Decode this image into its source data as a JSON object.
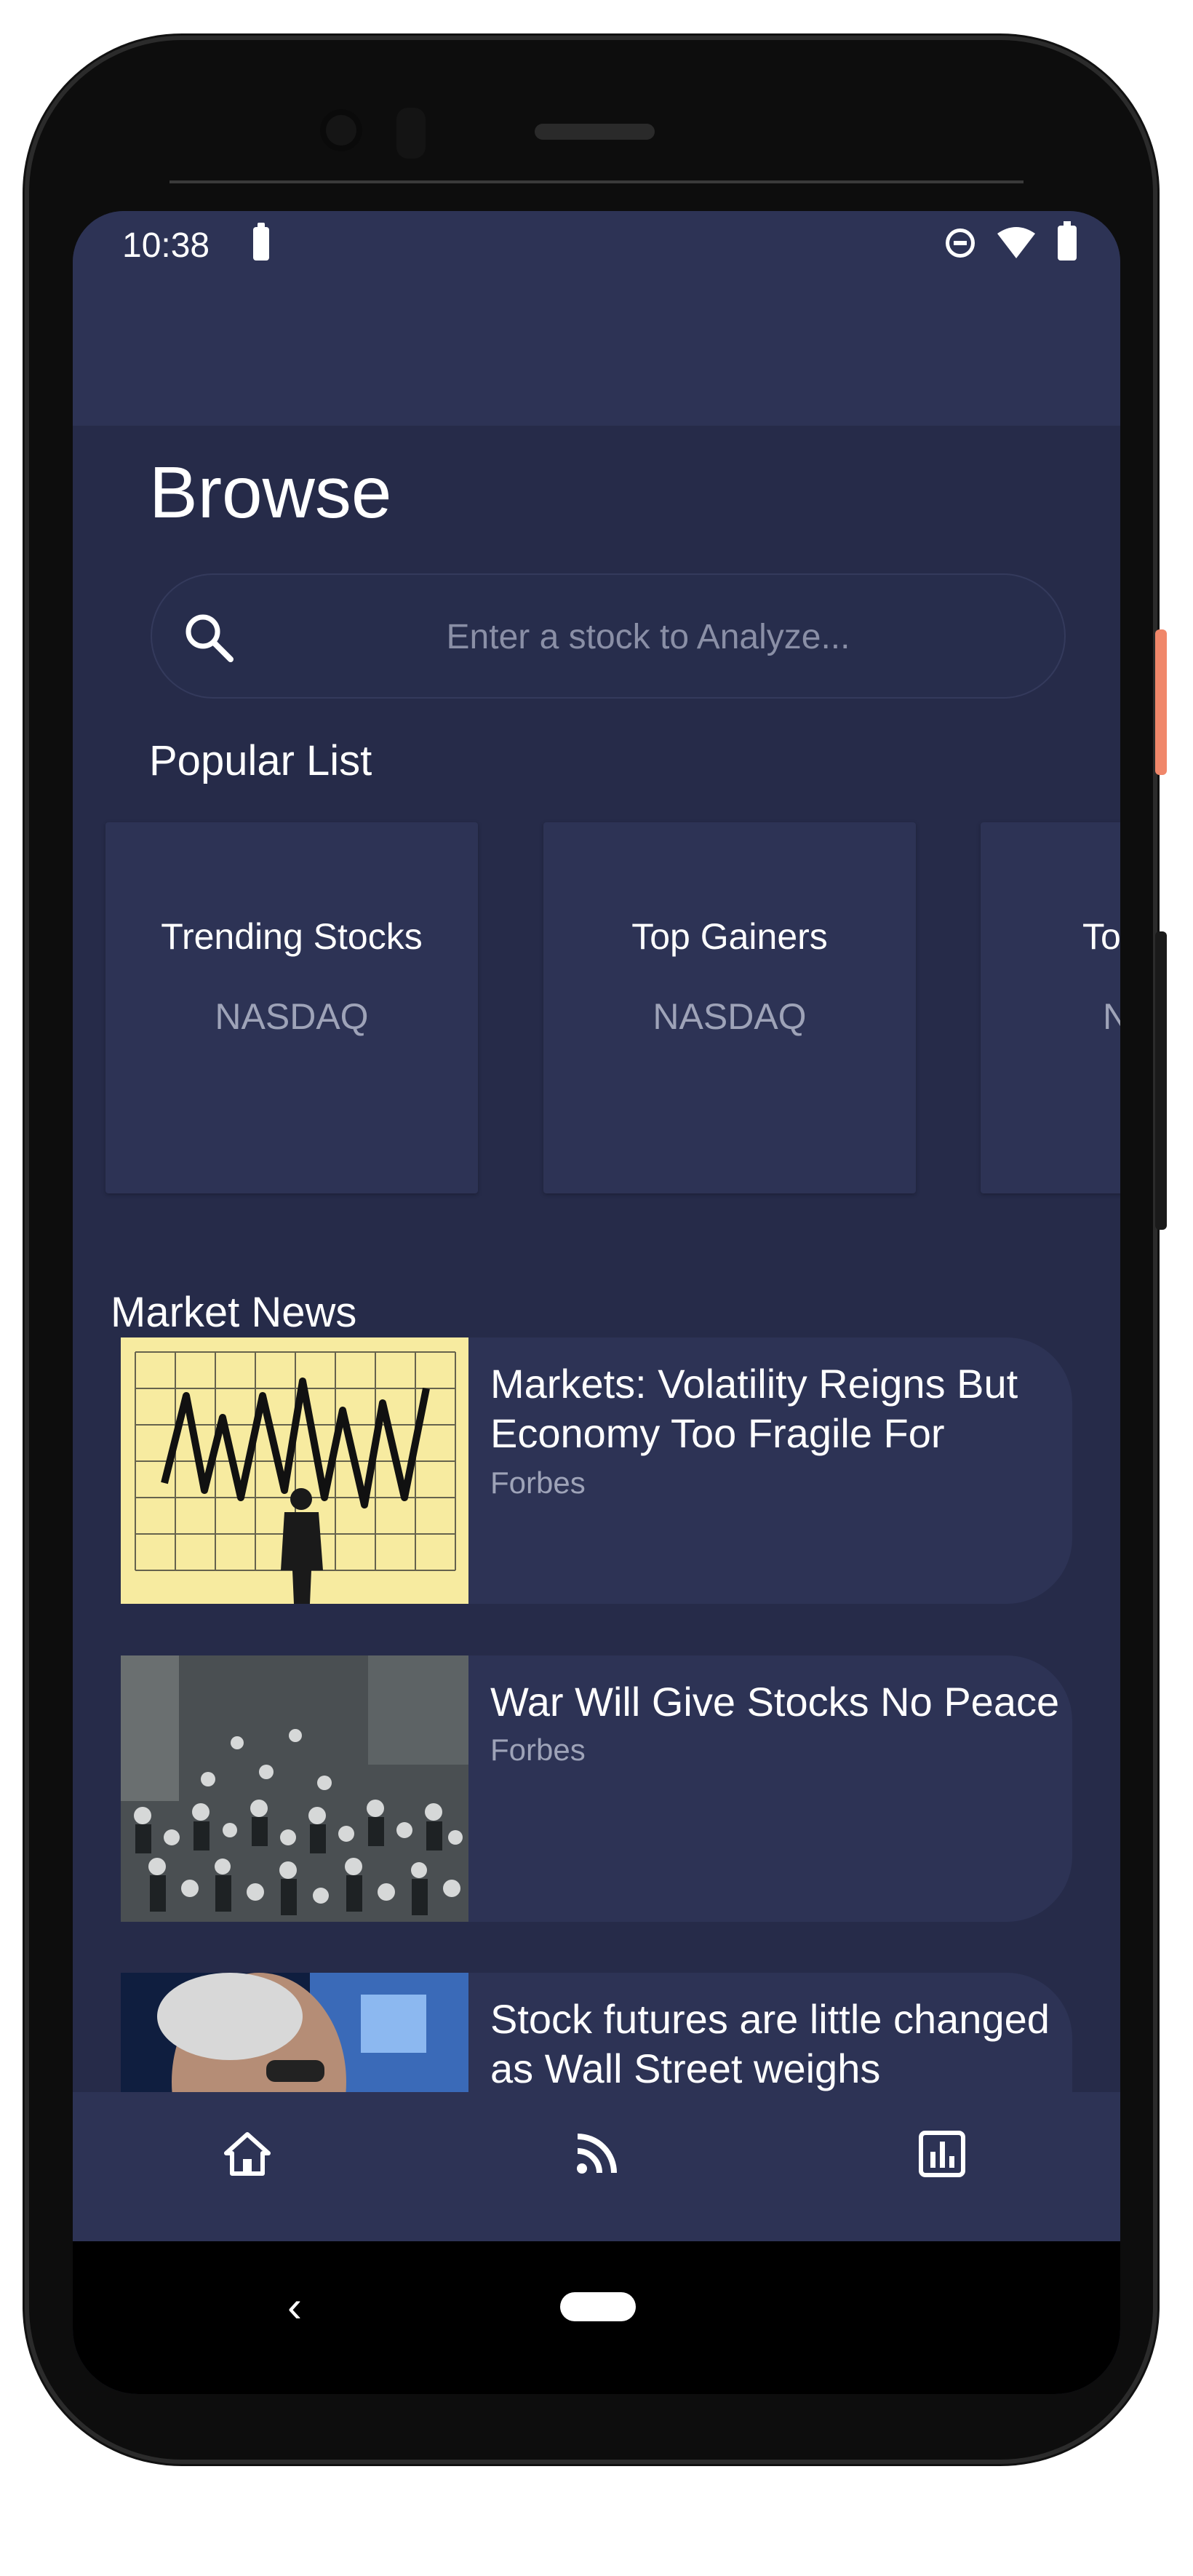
{
  "status_bar": {
    "time": "10:38"
  },
  "browse": {
    "title": "Browse",
    "search": {
      "placeholder": "Enter a stock to Analyze...",
      "value": ""
    },
    "popular": {
      "title": "Popular List",
      "cards": [
        {
          "title": "Trending Stocks",
          "subtitle": "NASDAQ"
        },
        {
          "title": "Top Gainers",
          "subtitle": "NASDAQ"
        },
        {
          "title": "To",
          "subtitle": "N"
        }
      ]
    },
    "news": {
      "title": "Market News",
      "items": [
        {
          "headline": "Markets: Volatility Reigns But Economy Too Fragile For",
          "source": "Forbes"
        },
        {
          "headline": "War Will Give Stocks No Peace",
          "source": "Forbes"
        },
        {
          "headline": "Stock futures are little changed as Wall Street weighs",
          "source": ""
        }
      ]
    }
  },
  "bottom_nav": {
    "items": [
      {
        "icon": "home-icon"
      },
      {
        "icon": "rss-feed-icon"
      },
      {
        "icon": "bar-chart-icon"
      }
    ]
  },
  "colors": {
    "background": "#262b49",
    "surface": "#2d3355",
    "text_primary": "#ffffff",
    "text_secondary": "#9ea3b8"
  }
}
